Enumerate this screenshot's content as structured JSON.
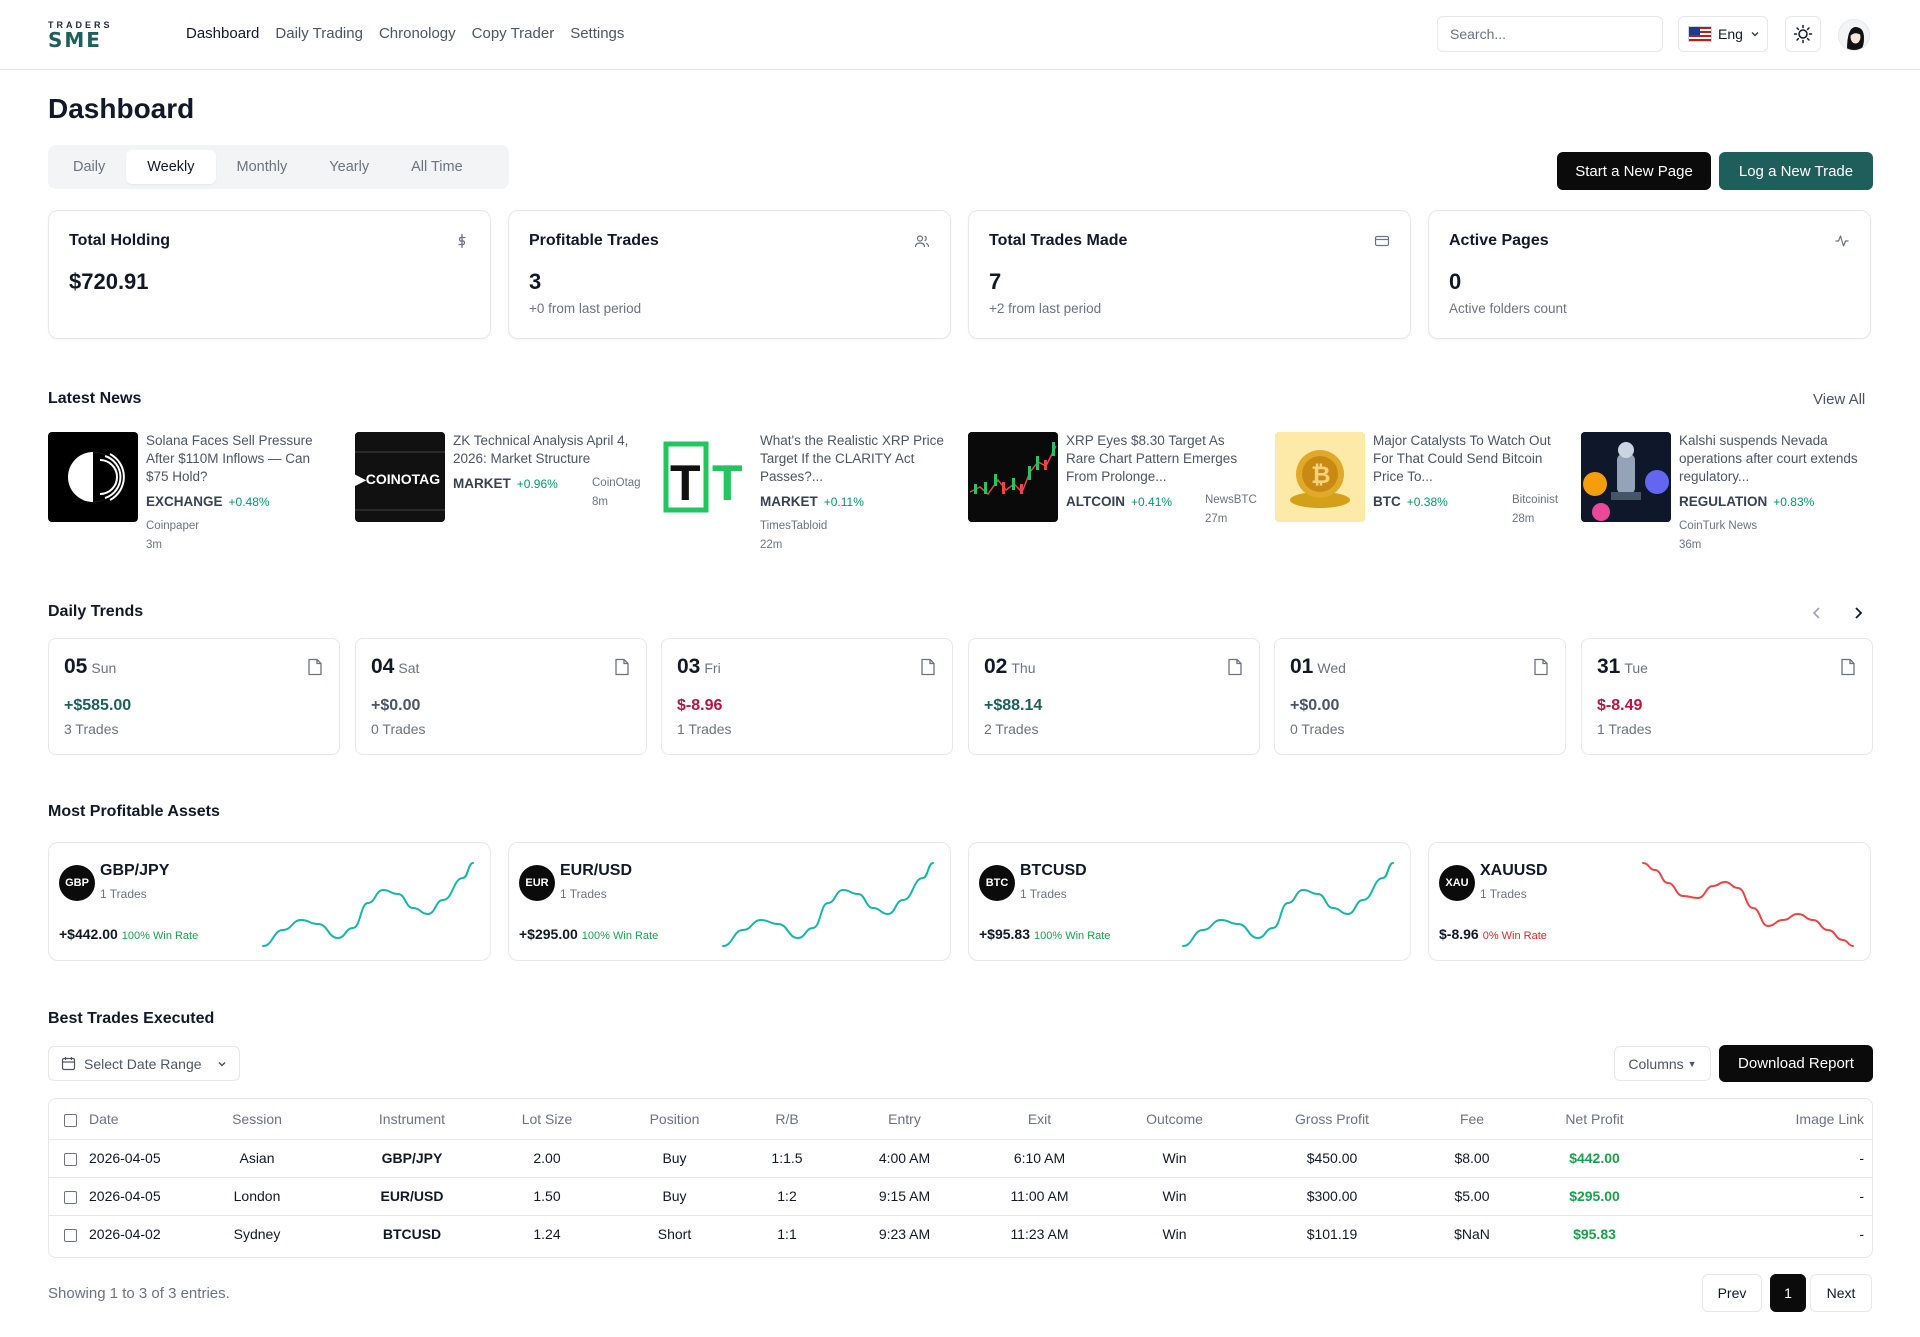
{
  "brand": {
    "line1": "TRADERS",
    "line2": "SME"
  },
  "nav": {
    "links": [
      "Dashboard",
      "Daily Trading",
      "Chronology",
      "Copy Trader",
      "Settings"
    ],
    "search_placeholder": "Search...",
    "language": "Eng"
  },
  "header": {
    "title": "Dashboard",
    "tabs": [
      "Daily",
      "Weekly",
      "Monthly",
      "Yearly",
      "All Time"
    ],
    "active_tab": "Weekly",
    "start_page_label": "Start a New Page",
    "log_trade_label": "Log a New Trade"
  },
  "stats": [
    {
      "title": "Total Holding",
      "value": "$720.91",
      "sub": "",
      "icon": "dollar-icon"
    },
    {
      "title": "Profitable Trades",
      "value": "3",
      "sub": "+0 from last period",
      "icon": "users-icon"
    },
    {
      "title": "Total Trades Made",
      "value": "7",
      "sub": "+2 from last period",
      "icon": "card-icon"
    },
    {
      "title": "Active Pages",
      "value": "0",
      "sub": "Active folders count",
      "icon": "activity-icon"
    }
  ],
  "news": {
    "title": "Latest News",
    "view_all": "View All",
    "items": [
      {
        "title": "Solana Faces Sell Pressure After $110M Inflows — Can $75 Hold?",
        "tag": "EXCHANGE",
        "change": "+0.48%",
        "source": "Coinpaper",
        "age": "3m",
        "thumb": "solana-thumb"
      },
      {
        "title": "ZK Technical Analysis April 4, 2026: Market Structure",
        "tag": "MARKET",
        "change": "+0.96%",
        "source": "CoinOtag",
        "age": "8m",
        "thumb": "coinotag-thumb"
      },
      {
        "title": "What's the Realistic XRP Price Target If the CLARITY Act Passes?...",
        "tag": "MARKET",
        "change": "+0.11%",
        "source": "TimesTabloid",
        "age": "22m",
        "thumb": "timestabloid-thumb"
      },
      {
        "title": "XRP Eyes $8.30 Target As Rare Chart Pattern Emerges From Prolonge...",
        "tag": "ALTCOIN",
        "change": "+0.41%",
        "source": "NewsBTC",
        "age": "27m",
        "thumb": "chart-thumb"
      },
      {
        "title": "Major Catalysts To Watch Out For That Could Send Bitcoin Price To...",
        "tag": "BTC",
        "change": "+0.38%",
        "source": "Bitcoinist",
        "age": "28m",
        "thumb": "bitcoin-thumb"
      },
      {
        "title": "Kalshi suspends Nevada operations after court extends regulatory...",
        "tag": "REGULATION",
        "change": "+0.83%",
        "source": "CoinTurk News",
        "age": "36m",
        "thumb": "kalshi-thumb"
      }
    ]
  },
  "trends": {
    "title": "Daily Trends",
    "days": [
      {
        "day": "05",
        "weekday": "Sun",
        "profit": "+$585.00",
        "trades": "3 Trades",
        "tone": "pos"
      },
      {
        "day": "04",
        "weekday": "Sat",
        "profit": "+$0.00",
        "trades": "0 Trades",
        "tone": "zero"
      },
      {
        "day": "03",
        "weekday": "Fri",
        "profit": "$-8.96",
        "trades": "1 Trades",
        "tone": "neg"
      },
      {
        "day": "02",
        "weekday": "Thu",
        "profit": "+$88.14",
        "trades": "2 Trades",
        "tone": "pos"
      },
      {
        "day": "01",
        "weekday": "Wed",
        "profit": "+$0.00",
        "trades": "0 Trades",
        "tone": "zero"
      },
      {
        "day": "31",
        "weekday": "Tue",
        "profit": "$-8.49",
        "trades": "1 Trades",
        "tone": "neg"
      }
    ]
  },
  "assets": {
    "title": "Most Profitable Assets",
    "items": [
      {
        "badge": "GBP",
        "name": "GBP/JPY",
        "trades": "1 Trades",
        "profit": "+$442.00",
        "win_rate": "100% Win Rate",
        "color": "#14b8a6",
        "trend": "up"
      },
      {
        "badge": "EUR",
        "name": "EUR/USD",
        "trades": "1 Trades",
        "profit": "+$295.00",
        "win_rate": "100% Win Rate",
        "color": "#14b8a6",
        "trend": "up"
      },
      {
        "badge": "BTC",
        "name": "BTCUSD",
        "trades": "1 Trades",
        "profit": "+$95.83",
        "win_rate": "100% Win Rate",
        "color": "#14b8a6",
        "trend": "up"
      },
      {
        "badge": "XAU",
        "name": "XAUUSD",
        "trades": "1 Trades",
        "profit": "$-8.96",
        "win_rate": "0% Win Rate",
        "color": "#ef4444",
        "trend": "down"
      }
    ]
  },
  "trades": {
    "title": "Best Trades Executed",
    "date_range_label": "Select Date Range",
    "columns_label": "Columns",
    "download_label": "Download Report",
    "headers": [
      "Date",
      "Session",
      "Instrument",
      "Lot Size",
      "Position",
      "R/B",
      "Entry",
      "Exit",
      "Outcome",
      "Gross Profit",
      "Fee",
      "Net Profit",
      "Image Link"
    ],
    "rows": [
      [
        "2026-04-05",
        "Asian",
        "GBP/JPY",
        "2.00",
        "Buy",
        "1:1.5",
        "4:00 AM",
        "6:10 AM",
        "Win",
        "$450.00",
        "$8.00",
        "$442.00",
        "-"
      ],
      [
        "2026-04-05",
        "London",
        "EUR/USD",
        "1.50",
        "Buy",
        "1:2",
        "9:15 AM",
        "11:00 AM",
        "Win",
        "$300.00",
        "$5.00",
        "$295.00",
        "-"
      ],
      [
        "2026-04-02",
        "Sydney",
        "BTCUSD",
        "1.24",
        "Short",
        "1:1",
        "9:23 AM",
        "11:23 AM",
        "Win",
        "$101.19",
        "$NaN",
        "$95.83",
        "-"
      ]
    ],
    "showing": "Showing 1 to 3 of 3 entries.",
    "prev": "Prev",
    "page": "1",
    "next": "Next"
  },
  "colors": {
    "accent": "#1f5f5b",
    "positive": "#16a34a",
    "negative": "#be123c",
    "dark": "#0b0b0b"
  }
}
